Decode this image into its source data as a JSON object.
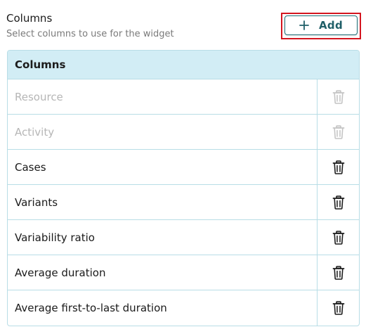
{
  "header": {
    "title": "Columns",
    "subtitle": "Select columns to use for the widget",
    "add_label": "Add",
    "add_icon": "plus-icon"
  },
  "table": {
    "header": "Columns",
    "rows": [
      {
        "label": "Resource",
        "disabled": true,
        "action_icon": "trash-icon"
      },
      {
        "label": "Activity",
        "disabled": true,
        "action_icon": "trash-icon"
      },
      {
        "label": "Cases",
        "disabled": false,
        "action_icon": "trash-icon"
      },
      {
        "label": "Variants",
        "disabled": false,
        "action_icon": "trash-icon"
      },
      {
        "label": "Variability ratio",
        "disabled": false,
        "action_icon": "trash-icon"
      },
      {
        "label": "Average duration",
        "disabled": false,
        "action_icon": "trash-icon"
      },
      {
        "label": "Average first-to-last duration",
        "disabled": false,
        "action_icon": "trash-icon"
      }
    ]
  },
  "colors": {
    "accent": "#1f5f68",
    "highlight_outline": "#d4151f",
    "table_header_bg": "#d2edf5",
    "border": "#b8dde6",
    "disabled_text": "#b6b6b6"
  }
}
